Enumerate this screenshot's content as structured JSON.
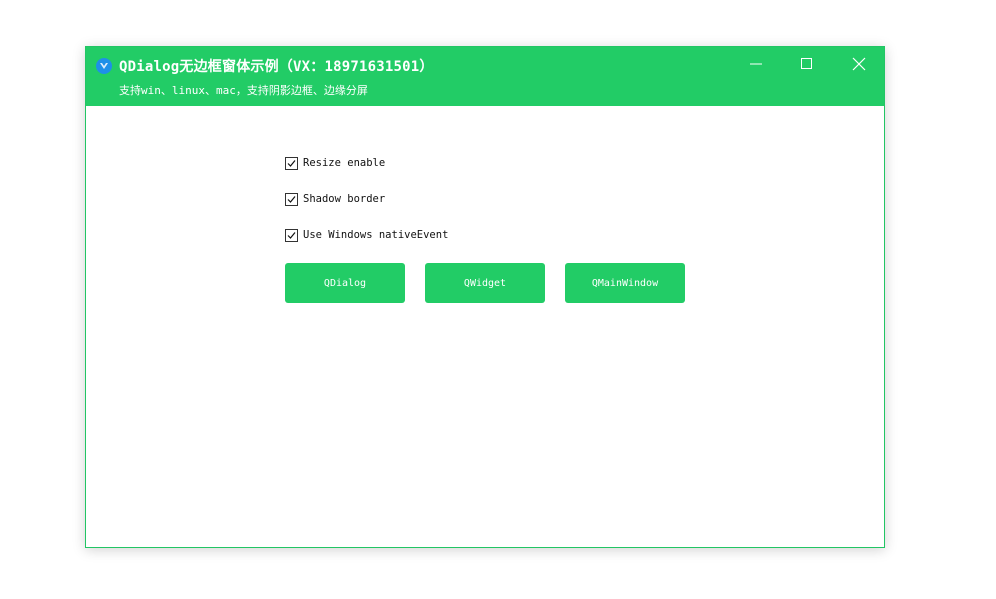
{
  "window": {
    "title": "QDialog无边框窗体示例（VX：18971631501）",
    "subtitle": "支持win、linux、mac，支持阴影边框、边缘分屏",
    "accent_color": "#22cc66",
    "icon": "app-logo-icon",
    "controls": {
      "minimize": "minimize-icon",
      "maximize": "maximize-icon",
      "close": "close-icon"
    }
  },
  "options": [
    {
      "label": "Resize enable",
      "checked": true
    },
    {
      "label": "Shadow border",
      "checked": true
    },
    {
      "label": "Use Windows nativeEvent",
      "checked": true
    }
  ],
  "buttons": [
    {
      "label": "QDialog"
    },
    {
      "label": "QWidget"
    },
    {
      "label": "QMainWindow"
    }
  ]
}
